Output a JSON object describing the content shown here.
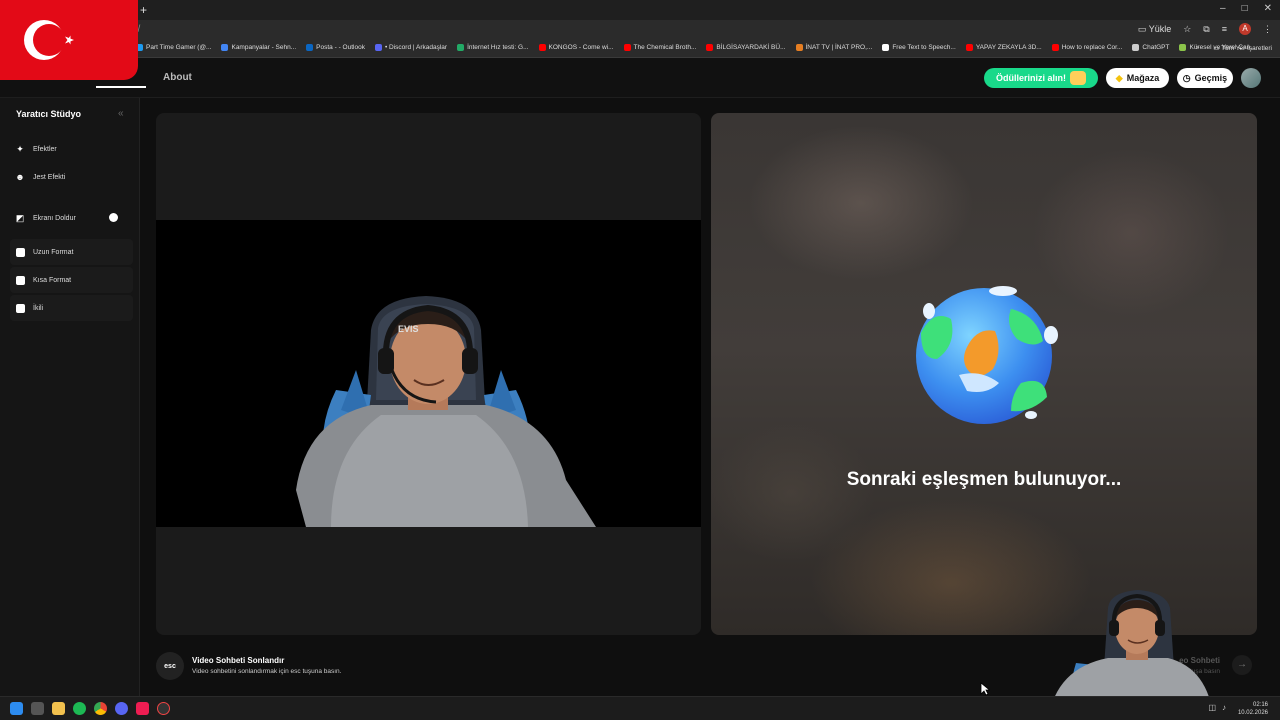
{
  "browser": {
    "new_tab_symbol": "+",
    "url": "ːt/",
    "window_controls": [
      "–",
      "□",
      "✕"
    ],
    "install_label": "Yükle",
    "profile_initial": "A",
    "bookmarks": [
      {
        "label": "Part Time Gamer (@...",
        "color": "#1d9bf0"
      },
      {
        "label": "Kampanyalar - Sehn...",
        "color": "#4285f4"
      },
      {
        "label": "Posta - - Outlook",
        "color": "#0a66c2"
      },
      {
        "label": "• Discord | Arkadaşlar",
        "color": "#5865f2"
      },
      {
        "label": "İnternet Hız testi: G...",
        "color": "#22aa66"
      },
      {
        "label": "KONGOS - Come wi...",
        "color": "#ff0000"
      },
      {
        "label": "The Chemical Broth...",
        "color": "#ff0000"
      },
      {
        "label": "BİLGİSAYARDAKİ BÜ...",
        "color": "#ff0000"
      },
      {
        "label": "İNAT TV | İNAT PRO,...",
        "color": "#e67e22"
      },
      {
        "label": "Free Text to Speech...",
        "color": "#ffffff"
      },
      {
        "label": "YAPAY ZEKAYLA 3D...",
        "color": "#ff0000"
      },
      {
        "label": "How to replace Cor...",
        "color": "#ff0000"
      },
      {
        "label": "ChatGPT",
        "color": "#cccccc"
      },
      {
        "label": "Küresel ve Yerel Can...",
        "color": "#8bc34a"
      }
    ],
    "bookmarks_overflow": "»",
    "all_bookmarks_label": "Tüm Yer İşaretleri"
  },
  "header": {
    "nav_active": "at",
    "nav_about": "About",
    "rewards_label": "Ödüllerinizi alın!",
    "shop_label": "Mağaza",
    "history_label": "Geçmiş"
  },
  "sidebar": {
    "title": "Yaratıcı Stüdyo",
    "collapse_symbol": "«",
    "items": [
      {
        "label": "Efektler",
        "icon": "magic-wand-icon"
      },
      {
        "label": "Jest Efekti",
        "icon": "smile-icon"
      },
      {
        "label": "Ekranı Doldur",
        "icon": "fill-screen-icon"
      },
      {
        "label": "Uzun Format",
        "icon": "long-format-icon"
      },
      {
        "label": "Kısa Format",
        "icon": "short-format-icon"
      },
      {
        "label": "İkili",
        "icon": "dual-icon"
      }
    ]
  },
  "remote": {
    "status": "Sonraki eşleşmen bulunuyor..."
  },
  "footer": {
    "esc_key": "esc",
    "end_title": "Video Sohbeti Sonlandır",
    "end_desc": "Video sohbetini sonlandırmak için esc tuşuna basın.",
    "next_title": "eo Sohbeti",
    "next_desc": "tuşa basın",
    "next_arrow": "→"
  },
  "taskbar": {
    "time": "02:16",
    "date": "10.02.2026"
  },
  "colors": {
    "accent_green": "#19d98a",
    "flag_red": "#e30a17"
  }
}
